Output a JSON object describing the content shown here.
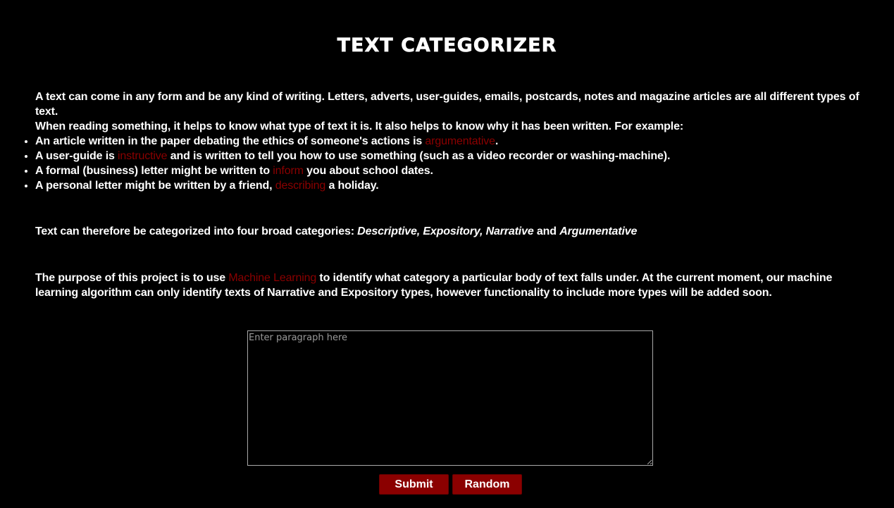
{
  "page": {
    "title": "TEXT CATEGORIZER"
  },
  "intro": {
    "line1": "A text can come in any form and be any kind of writing. Letters, adverts, user-guides, emails, postcards, notes and magazine articles are all different types of text.",
    "line2": "When reading something, it helps to know what type of text it is. It also helps to know why it has been written. For example:"
  },
  "examples": [
    {
      "before": "An article written in the paper debating the ethics of someone's actions is ",
      "highlight": "argumentative",
      "after": "."
    },
    {
      "before": "A user-guide is ",
      "highlight": "instructive",
      "after": " and is written to tell you how to use something (such as a video recorder or washing-machine)."
    },
    {
      "before": "A formal (business) letter might be written to ",
      "highlight": "inform",
      "after": " you about school dates."
    },
    {
      "before": "A personal letter might be written by a friend, ",
      "highlight": "describing",
      "after": " a holiday."
    }
  ],
  "categories": {
    "prefix": "Text can therefore be categorized into four broad categories: ",
    "cat1": "Descriptive,",
    "cat2": "Expository,",
    "cat3": "Narrative",
    "and": " and ",
    "cat4": "Argumentative"
  },
  "purpose": {
    "before": "The purpose of this project is to use ",
    "highlight": "Machine Learning",
    "after": " to identify what category a particular body of text falls under. At the current moment, our machine learning algorithm can only identify texts of Narrative and Expository types, however functionality to include more types will be added soon."
  },
  "input": {
    "placeholder": "Enter paragraph here",
    "value": ""
  },
  "buttons": {
    "submit_label": "Submit",
    "random_label": "Random"
  },
  "colors": {
    "background": "#000000",
    "text": "#ffffff",
    "highlight": "#8b0000",
    "button": "#8b0000"
  }
}
